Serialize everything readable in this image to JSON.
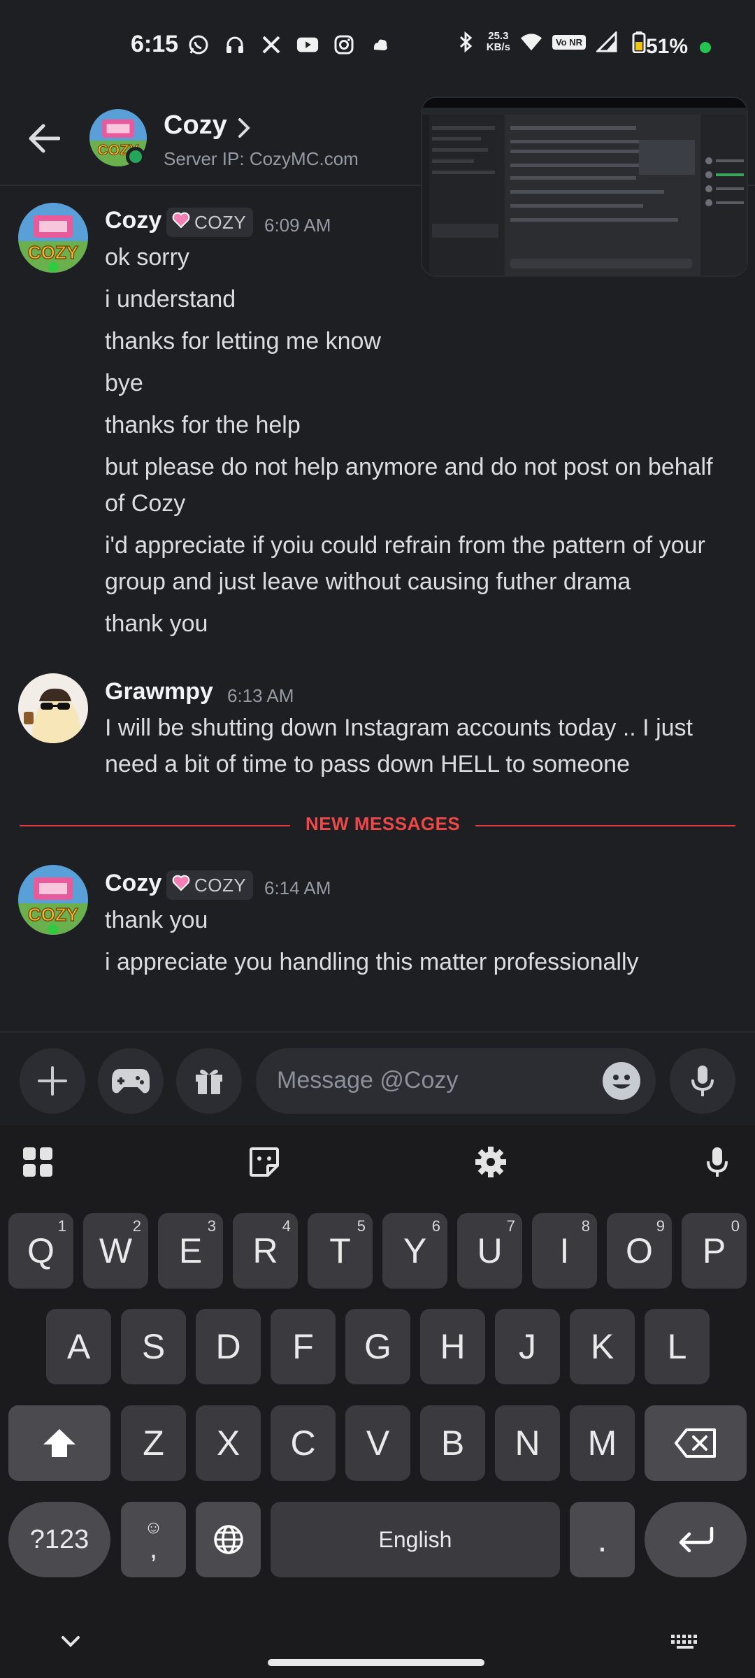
{
  "status_bar": {
    "time": "6:15",
    "net_speed_value": "25.3",
    "net_speed_unit": "KB/s",
    "volte": "Vo NR",
    "battery": "51%"
  },
  "header": {
    "title": "Cozy",
    "subtitle": "Server IP: CozyMC.com"
  },
  "messages": [
    {
      "author": "Cozy",
      "tag": "COZY",
      "time": "6:09 AM",
      "lines": [
        "ok sorry",
        "i understand",
        "thanks for letting me know",
        "bye",
        "thanks for the help",
        "but please do not help anymore and do not post on behalf of Cozy",
        "i'd appreciate if yoiu could refrain from the pattern of your group and just leave without causing futher drama",
        "thank you"
      ]
    },
    {
      "author": "Grawmpy",
      "time": "6:13 AM",
      "lines": [
        "I will be shutting down Instagram accounts today .. I just need a bit of time to pass down HELL to someone"
      ]
    },
    {
      "author": "Cozy",
      "tag": "COZY",
      "time": "6:14 AM",
      "lines": [
        "thank you",
        "i appreciate you handling this matter professionally"
      ]
    }
  ],
  "divider_label": "NEW MESSAGES",
  "composer": {
    "placeholder": "Message @Cozy"
  },
  "keyboard": {
    "row1": [
      {
        "k": "Q",
        "n": "1"
      },
      {
        "k": "W",
        "n": "2"
      },
      {
        "k": "E",
        "n": "3"
      },
      {
        "k": "R",
        "n": "4"
      },
      {
        "k": "T",
        "n": "5"
      },
      {
        "k": "Y",
        "n": "6"
      },
      {
        "k": "U",
        "n": "7"
      },
      {
        "k": "I",
        "n": "8"
      },
      {
        "k": "O",
        "n": "9"
      },
      {
        "k": "P",
        "n": "0"
      }
    ],
    "row2": [
      "A",
      "S",
      "D",
      "F",
      "G",
      "H",
      "J",
      "K",
      "L"
    ],
    "row3": [
      "Z",
      "X",
      "C",
      "V",
      "B",
      "N",
      "M"
    ],
    "symbols_key": "?123",
    "comma_key": ",",
    "space_label": "English",
    "period_key": "."
  },
  "colors": {
    "background": "#1e1f23",
    "accent_red": "#f04747",
    "online_green": "#23a55a",
    "tag_heart": "#f47fb5"
  }
}
